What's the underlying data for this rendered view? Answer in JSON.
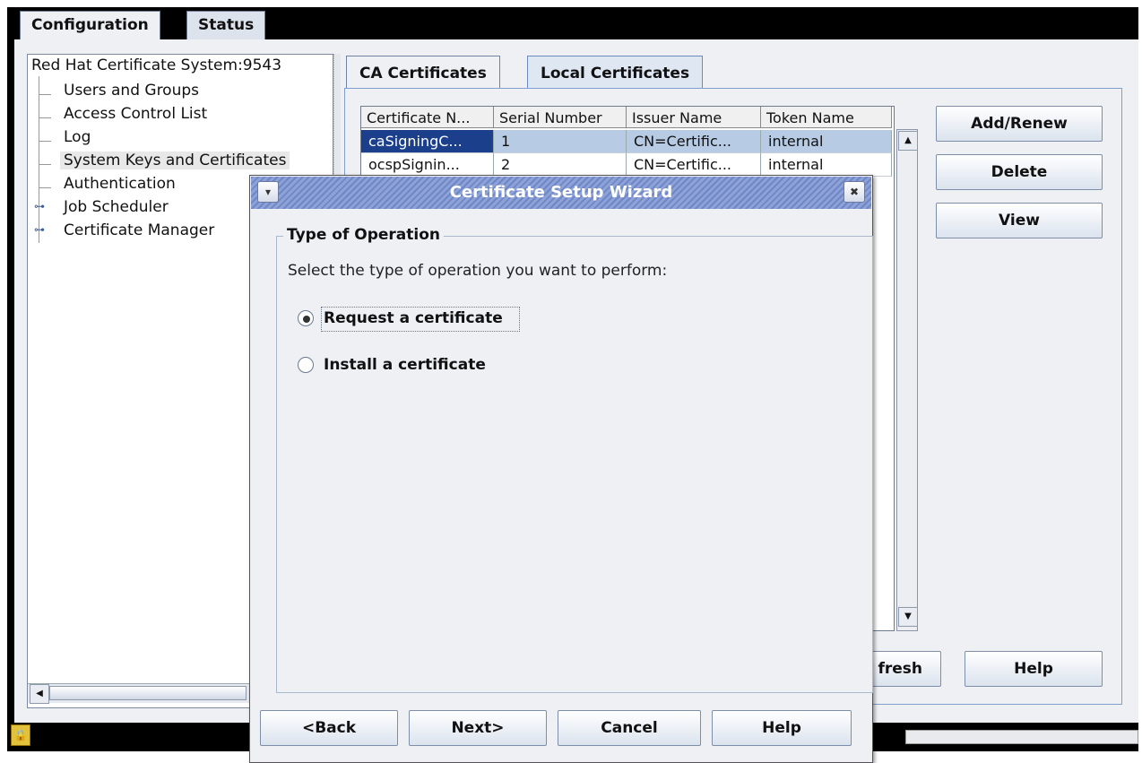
{
  "tabs": {
    "configuration": "Configuration",
    "status": "Status"
  },
  "tree": {
    "root": "Red Hat Certificate System:9543",
    "items": [
      "Users and Groups",
      "Access Control List",
      "Log",
      "System Keys and Certificates",
      "Authentication",
      "Job Scheduler",
      "Certificate Manager"
    ]
  },
  "subtabs": {
    "ca": "CA Certificates",
    "local": "Local Certificates"
  },
  "table": {
    "headers": [
      "Certificate N...",
      "Serial Number",
      "Issuer Name",
      "Token Name"
    ],
    "rows": [
      [
        "caSigningC...",
        "1",
        "CN=Certific...",
        "internal"
      ],
      [
        "ocspSignin...",
        "2",
        "CN=Certific...",
        "internal"
      ]
    ]
  },
  "side_buttons": {
    "add": "Add/Renew",
    "delete": "Delete",
    "view": "View"
  },
  "bottom_buttons": {
    "refresh_partial": "fresh",
    "help": "Help"
  },
  "dialog": {
    "title": "Certificate Setup Wizard",
    "group_title": "Type of Operation",
    "instruction": "Select the type of operation you want to perform:",
    "option_request": "Request a certificate",
    "option_install": "Install a certificate",
    "selected": "request",
    "buttons": {
      "back": "<Back",
      "next": "Next>",
      "cancel": "Cancel",
      "help": "Help"
    }
  },
  "colors": {
    "selection": "#1b3f8b",
    "title_bar": "#7a91cc"
  }
}
